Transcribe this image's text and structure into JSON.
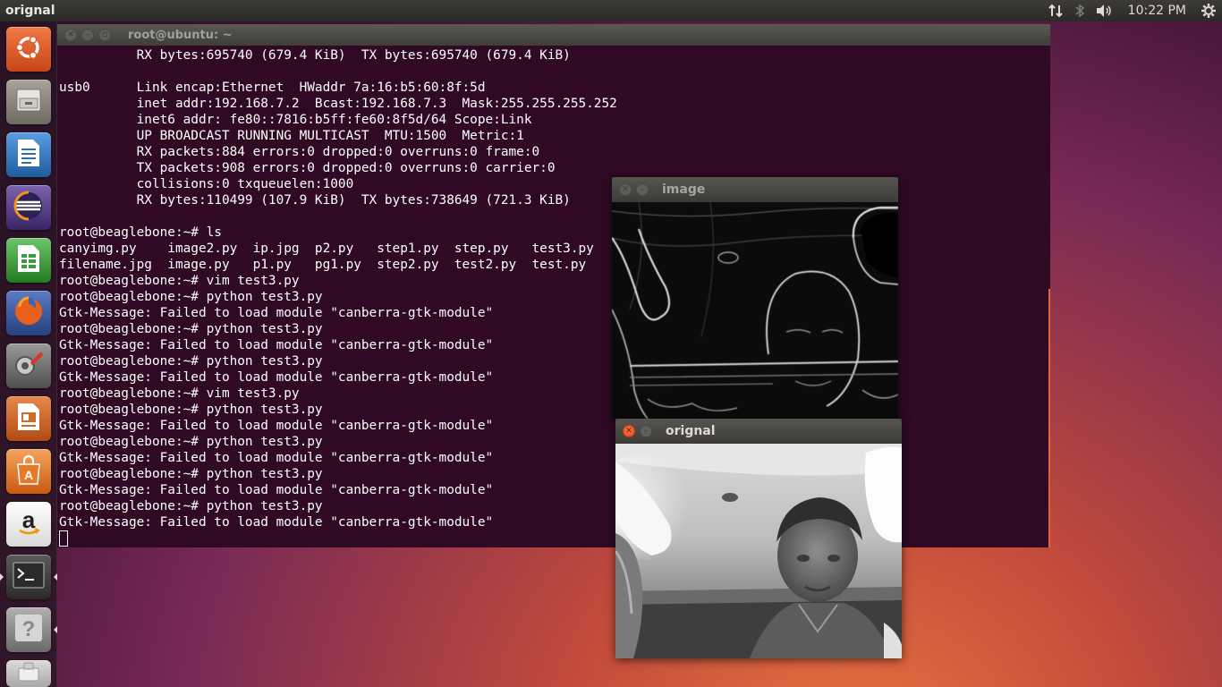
{
  "top_panel": {
    "app_title": "orignal",
    "clock": "10:22 PM",
    "icons": [
      "network-updown-icon",
      "bluetooth-icon",
      "volume-icon",
      "gear-icon"
    ]
  },
  "launcher": {
    "items": [
      {
        "name": "ubuntu-dash",
        "icon": "ubuntu-logo-icon",
        "color": "#e0592a"
      },
      {
        "name": "files",
        "icon": "file-cabinet-icon",
        "color": "#8f8a80"
      },
      {
        "name": "libreoffice-writer",
        "icon": "writer-document-icon",
        "color": "#2e6db3"
      },
      {
        "name": "eclipse",
        "icon": "eclipse-icon",
        "color": "#5b3f8a"
      },
      {
        "name": "libreoffice-calc",
        "icon": "calc-spreadsheet-icon",
        "color": "#3d9a3d"
      },
      {
        "name": "firefox",
        "icon": "firefox-icon",
        "color": "#e66a1c"
      },
      {
        "name": "system-settings",
        "icon": "settings-wrench-icon",
        "color": "#777777"
      },
      {
        "name": "libreoffice-impress",
        "icon": "impress-presentation-icon",
        "color": "#d06a2a"
      },
      {
        "name": "software-center",
        "icon": "shopping-bag-icon",
        "color": "#e8782a"
      },
      {
        "name": "amazon",
        "icon": "amazon-icon",
        "color": "#f2f2f2"
      },
      {
        "name": "terminal",
        "icon": "terminal-icon",
        "color": "#3a3a3a"
      },
      {
        "name": "help",
        "icon": "question-mark-icon",
        "color": "#8a8a8a"
      },
      {
        "name": "usb-drive",
        "icon": "usb-drive-icon",
        "color": "#bdbdbd"
      }
    ]
  },
  "terminal": {
    "title": "root@ubuntu: ~",
    "lines": [
      "          RX bytes:695740 (679.4 KiB)  TX bytes:695740 (679.4 KiB)",
      "",
      "usb0      Link encap:Ethernet  HWaddr 7a:16:b5:60:8f:5d",
      "          inet addr:192.168.7.2  Bcast:192.168.7.3  Mask:255.255.255.252",
      "          inet6 addr: fe80::7816:b5ff:fe60:8f5d/64 Scope:Link",
      "          UP BROADCAST RUNNING MULTICAST  MTU:1500  Metric:1",
      "          RX packets:884 errors:0 dropped:0 overruns:0 frame:0",
      "          TX packets:908 errors:0 dropped:0 overruns:0 carrier:0",
      "          collisions:0 txqueuelen:1000",
      "          RX bytes:110499 (107.9 KiB)  TX bytes:738649 (721.3 KiB)",
      "",
      "root@beaglebone:~# ls",
      "canyimg.py    image2.py  ip.jpg  p2.py   step1.py  step.py   test3.py",
      "filename.jpg  image.py   p1.py   pg1.py  step2.py  test2.py  test.py",
      "root@beaglebone:~# vim test3.py",
      "root@beaglebone:~# python test3.py",
      "Gtk-Message: Failed to load module \"canberra-gtk-module\"",
      "root@beaglebone:~# python test3.py",
      "Gtk-Message: Failed to load module \"canberra-gtk-module\"",
      "root@beaglebone:~# python test3.py",
      "Gtk-Message: Failed to load module \"canberra-gtk-module\"",
      "root@beaglebone:~# vim test3.py",
      "root@beaglebone:~# python test3.py",
      "Gtk-Message: Failed to load module \"canberra-gtk-module\"",
      "root@beaglebone:~# python test3.py",
      "Gtk-Message: Failed to load module \"canberra-gtk-module\"",
      "root@beaglebone:~# python test3.py",
      "Gtk-Message: Failed to load module \"canberra-gtk-module\"",
      "root@beaglebone:~# python test3.py",
      "Gtk-Message: Failed to load module \"canberra-gtk-module\""
    ]
  },
  "image_window": {
    "title": "image"
  },
  "orignal_window": {
    "title": "orignal"
  },
  "colors": {
    "terminal_bg": "#300a24",
    "accent_orange": "#e5633a",
    "close_button": "#df4a16"
  }
}
